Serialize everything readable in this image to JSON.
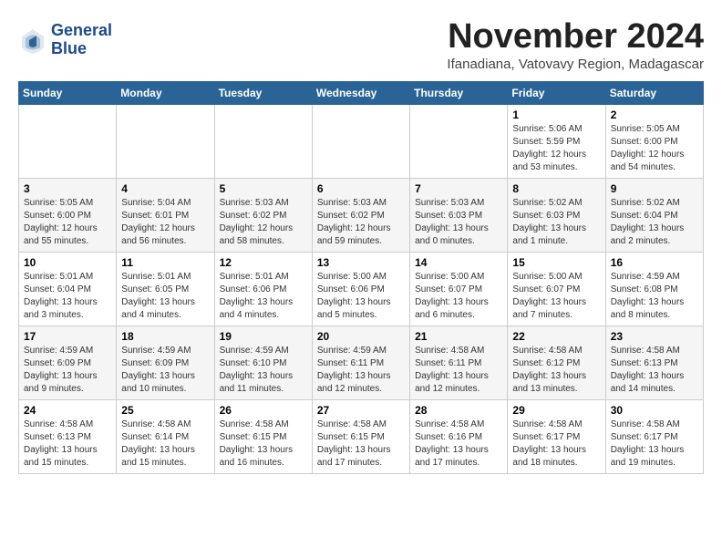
{
  "header": {
    "logo_line1": "General",
    "logo_line2": "Blue",
    "month_title": "November 2024",
    "subtitle": "Ifanadiana, Vatovavy Region, Madagascar"
  },
  "weekdays": [
    "Sunday",
    "Monday",
    "Tuesday",
    "Wednesday",
    "Thursday",
    "Friday",
    "Saturday"
  ],
  "weeks": [
    [
      {
        "day": "",
        "info": ""
      },
      {
        "day": "",
        "info": ""
      },
      {
        "day": "",
        "info": ""
      },
      {
        "day": "",
        "info": ""
      },
      {
        "day": "",
        "info": ""
      },
      {
        "day": "1",
        "info": "Sunrise: 5:06 AM\nSunset: 5:59 PM\nDaylight: 12 hours\nand 53 minutes."
      },
      {
        "day": "2",
        "info": "Sunrise: 5:05 AM\nSunset: 6:00 PM\nDaylight: 12 hours\nand 54 minutes."
      }
    ],
    [
      {
        "day": "3",
        "info": "Sunrise: 5:05 AM\nSunset: 6:00 PM\nDaylight: 12 hours\nand 55 minutes."
      },
      {
        "day": "4",
        "info": "Sunrise: 5:04 AM\nSunset: 6:01 PM\nDaylight: 12 hours\nand 56 minutes."
      },
      {
        "day": "5",
        "info": "Sunrise: 5:03 AM\nSunset: 6:02 PM\nDaylight: 12 hours\nand 58 minutes."
      },
      {
        "day": "6",
        "info": "Sunrise: 5:03 AM\nSunset: 6:02 PM\nDaylight: 12 hours\nand 59 minutes."
      },
      {
        "day": "7",
        "info": "Sunrise: 5:03 AM\nSunset: 6:03 PM\nDaylight: 13 hours\nand 0 minutes."
      },
      {
        "day": "8",
        "info": "Sunrise: 5:02 AM\nSunset: 6:03 PM\nDaylight: 13 hours\nand 1 minute."
      },
      {
        "day": "9",
        "info": "Sunrise: 5:02 AM\nSunset: 6:04 PM\nDaylight: 13 hours\nand 2 minutes."
      }
    ],
    [
      {
        "day": "10",
        "info": "Sunrise: 5:01 AM\nSunset: 6:04 PM\nDaylight: 13 hours\nand 3 minutes."
      },
      {
        "day": "11",
        "info": "Sunrise: 5:01 AM\nSunset: 6:05 PM\nDaylight: 13 hours\nand 4 minutes."
      },
      {
        "day": "12",
        "info": "Sunrise: 5:01 AM\nSunset: 6:06 PM\nDaylight: 13 hours\nand 4 minutes."
      },
      {
        "day": "13",
        "info": "Sunrise: 5:00 AM\nSunset: 6:06 PM\nDaylight: 13 hours\nand 5 minutes."
      },
      {
        "day": "14",
        "info": "Sunrise: 5:00 AM\nSunset: 6:07 PM\nDaylight: 13 hours\nand 6 minutes."
      },
      {
        "day": "15",
        "info": "Sunrise: 5:00 AM\nSunset: 6:07 PM\nDaylight: 13 hours\nand 7 minutes."
      },
      {
        "day": "16",
        "info": "Sunrise: 4:59 AM\nSunset: 6:08 PM\nDaylight: 13 hours\nand 8 minutes."
      }
    ],
    [
      {
        "day": "17",
        "info": "Sunrise: 4:59 AM\nSunset: 6:09 PM\nDaylight: 13 hours\nand 9 minutes."
      },
      {
        "day": "18",
        "info": "Sunrise: 4:59 AM\nSunset: 6:09 PM\nDaylight: 13 hours\nand 10 minutes."
      },
      {
        "day": "19",
        "info": "Sunrise: 4:59 AM\nSunset: 6:10 PM\nDaylight: 13 hours\nand 11 minutes."
      },
      {
        "day": "20",
        "info": "Sunrise: 4:59 AM\nSunset: 6:11 PM\nDaylight: 13 hours\nand 12 minutes."
      },
      {
        "day": "21",
        "info": "Sunrise: 4:58 AM\nSunset: 6:11 PM\nDaylight: 13 hours\nand 12 minutes."
      },
      {
        "day": "22",
        "info": "Sunrise: 4:58 AM\nSunset: 6:12 PM\nDaylight: 13 hours\nand 13 minutes."
      },
      {
        "day": "23",
        "info": "Sunrise: 4:58 AM\nSunset: 6:13 PM\nDaylight: 13 hours\nand 14 minutes."
      }
    ],
    [
      {
        "day": "24",
        "info": "Sunrise: 4:58 AM\nSunset: 6:13 PM\nDaylight: 13 hours\nand 15 minutes."
      },
      {
        "day": "25",
        "info": "Sunrise: 4:58 AM\nSunset: 6:14 PM\nDaylight: 13 hours\nand 15 minutes."
      },
      {
        "day": "26",
        "info": "Sunrise: 4:58 AM\nSunset: 6:15 PM\nDaylight: 13 hours\nand 16 minutes."
      },
      {
        "day": "27",
        "info": "Sunrise: 4:58 AM\nSunset: 6:15 PM\nDaylight: 13 hours\nand 17 minutes."
      },
      {
        "day": "28",
        "info": "Sunrise: 4:58 AM\nSunset: 6:16 PM\nDaylight: 13 hours\nand 17 minutes."
      },
      {
        "day": "29",
        "info": "Sunrise: 4:58 AM\nSunset: 6:17 PM\nDaylight: 13 hours\nand 18 minutes."
      },
      {
        "day": "30",
        "info": "Sunrise: 4:58 AM\nSunset: 6:17 PM\nDaylight: 13 hours\nand 19 minutes."
      }
    ]
  ]
}
